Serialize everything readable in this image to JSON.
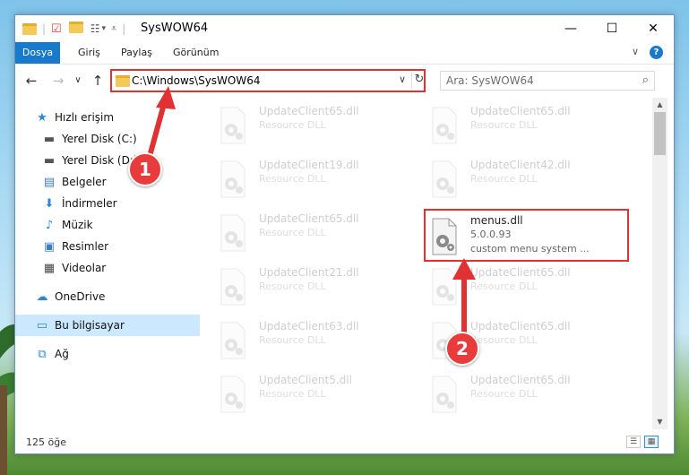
{
  "window": {
    "title": "SysWOW64",
    "minimize_glyph": "—",
    "maximize_glyph": "☐",
    "close_glyph": "✕",
    "help_glyph": "?",
    "expand_glyph": "∨"
  },
  "ribbon": {
    "tabs": [
      "Dosya",
      "Giriş",
      "Paylaş",
      "Görünüm"
    ]
  },
  "address": {
    "path": "C:\\Windows\\SysWOW64",
    "refresh_glyph": "↻",
    "chevron_glyph": "∨"
  },
  "search": {
    "placeholder": "Ara: SysWOW64",
    "icon": "search-icon"
  },
  "nav": {
    "back_glyph": "←",
    "forward_glyph": "→",
    "recent_glyph": "∨",
    "up_glyph": "↑",
    "items": [
      {
        "label": "Hızlı erişim",
        "icon": "star-icon",
        "pinned": false
      },
      {
        "label": "Yerel Disk (C:)",
        "icon": "drive-icon",
        "pinned": true
      },
      {
        "label": "Yerel Disk (D:)",
        "icon": "drive-icon",
        "pinned": true
      },
      {
        "label": "Belgeler",
        "icon": "documents-icon",
        "pinned": true
      },
      {
        "label": "İndirmeler",
        "icon": "downloads-icon",
        "pinned": true
      },
      {
        "label": "Müzik",
        "icon": "music-icon",
        "pinned": true
      },
      {
        "label": "Resimler",
        "icon": "pictures-icon",
        "pinned": true
      },
      {
        "label": "Videolar",
        "icon": "videos-icon",
        "pinned": true
      },
      {
        "label": "OneDrive",
        "icon": "cloud-icon",
        "pinned": false
      },
      {
        "label": "Bu bilgisayar",
        "icon": "computer-icon",
        "pinned": false
      },
      {
        "label": "Ağ",
        "icon": "network-icon",
        "pinned": false
      }
    ]
  },
  "files": {
    "left": [
      {
        "name": "UpdateClient65.dll",
        "sub": "Resource DLL"
      },
      {
        "name": "UpdateClient19.dll",
        "sub": "Resource DLL"
      },
      {
        "name": "UpdateClient65.dll",
        "sub": "Resource DLL"
      },
      {
        "name": "UpdateClient21.dll",
        "sub": "Resource DLL"
      },
      {
        "name": "UpdateClient63.dll",
        "sub": "Resource DLL"
      },
      {
        "name": "UpdateClient5.dll",
        "sub": "Resource DLL"
      }
    ],
    "right": [
      {
        "name": "UpdateClient65.dll",
        "sub": "Resource DLL"
      },
      {
        "name": "UpdateClient42.dll",
        "sub": "Resource DLL"
      },
      {
        "name": "menus.dll",
        "sub": "5.0.0.93",
        "sub2": "custom menu system ..."
      },
      {
        "name": "UpdateClient65.dll",
        "sub": "Resource DLL"
      },
      {
        "name": "UpdateClient65.dll",
        "sub": "Resource DLL"
      },
      {
        "name": "UpdateClient65.dll",
        "sub": "Resource DLL"
      }
    ]
  },
  "status": {
    "count": "125 öğe"
  },
  "annotations": {
    "step1": "1",
    "step2": "2",
    "color": "#e03232"
  }
}
